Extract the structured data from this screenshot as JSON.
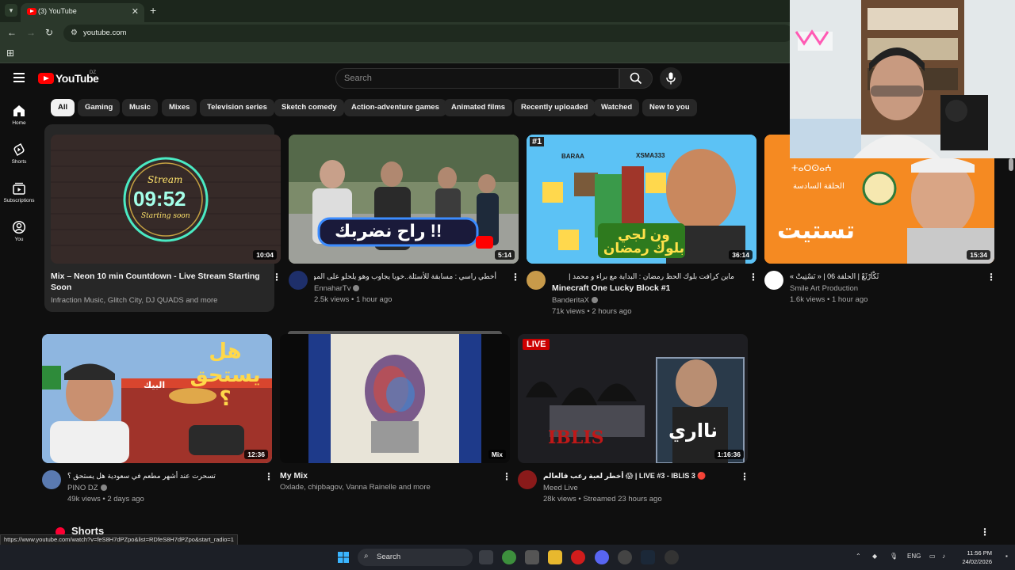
{
  "browser": {
    "tab_title": "(3) YouTube",
    "url": "youtube.com"
  },
  "header": {
    "logo_text": "YouTube",
    "country_code": "DZ",
    "search_placeholder": "Search"
  },
  "sidebar": {
    "items": [
      {
        "label": "Home",
        "icon": "home-icon"
      },
      {
        "label": "Shorts",
        "icon": "shorts-icon"
      },
      {
        "label": "Subscriptions",
        "icon": "subscriptions-icon"
      },
      {
        "label": "You",
        "icon": "you-icon"
      }
    ]
  },
  "chips": [
    "All",
    "Gaming",
    "Music",
    "Mixes",
    "Television series",
    "Sketch comedy",
    "Action-adventure games",
    "Animated films",
    "Recently uploaded",
    "Watched",
    "New to you"
  ],
  "videos": [
    {
      "title": "Mix – Neon 10 min Countdown - Live Stream Starting",
      "title2": "Soon",
      "channel": "Infraction Music, Glitch City, DJ QUADS and more",
      "duration": "10:04",
      "thumb_text_1": "Stream",
      "thumb_text_2": "09:52",
      "thumb_text_3": "Starting soon"
    },
    {
      "title": "أخطي راسي : مسابقة للأسئلة..خويا يجاوب وهو يلحلو على المورال",
      "channel": "EnnaharTv",
      "views": "2.5k views • 1 hour ago",
      "duration": "5:14",
      "thumb_text": "راح نضربك !!"
    },
    {
      "title": "ماين كرافت بلوك الحظ رمضان : البداية مع براء و محمد |",
      "title2": "Minecraft One Lucky Block #1",
      "channel": "BanderitaX",
      "views": "71k views • 2 hours ago",
      "duration": "36:14",
      "thumb_text": "ون لجي بلوك رمضان",
      "thumb_badge": "#1",
      "thumb_name_1": "BARAA",
      "thumb_name_2": "XSMA333"
    },
    {
      "title": "ثَكْاَرْثَعْ | الحلقة 06 | « نَسْتِيتْ »",
      "channel": "Smile Art Production",
      "views": "1.6k views • 1 hour ago",
      "duration": "15:34",
      "thumb_text": "تستيت",
      "thumb_top": "الحلقة السادسة",
      "thumb_latin": "ⵜⴰⵔⵙⴰⵄ"
    },
    {
      "title": "تسحرت عند أشهر مطعم في سعودية هل يستحق ؟",
      "channel": "PINO DZ",
      "views": "49k views • 2 days ago",
      "duration": "12:36",
      "thumb_text": "هل يستحق ؟",
      "thumb_sign": "البيك"
    },
    {
      "title": "My Mix",
      "channel": "Oxlade, chipbagov, Vanna Rainelle and more",
      "duration_label": "Mix"
    },
    {
      "title": "أخطر لعبة رعب فالعالم 😱 | LIVE #3 - IBLIS 3 🔴",
      "channel": "Meed Live",
      "views": "28k views • Streamed 23 hours ago",
      "duration": "1:16:36",
      "live_badge": "LIVE",
      "thumb_text": "IBLIS",
      "thumb_text_2": "نااري"
    }
  ],
  "shorts_label": "Shorts",
  "status_url": "https://www.youtube.com/watch?v=feS8H7dPZpo&list=RDfeS8H7dPZpo&start_radio=1",
  "taskbar": {
    "search_label": "Search",
    "lang": "ENG",
    "time": "11:56 PM",
    "date": "24/02/2026"
  },
  "colors": {
    "yt_red": "#ff0000",
    "bg": "#0f0f0f",
    "chip_bg": "#272727"
  }
}
